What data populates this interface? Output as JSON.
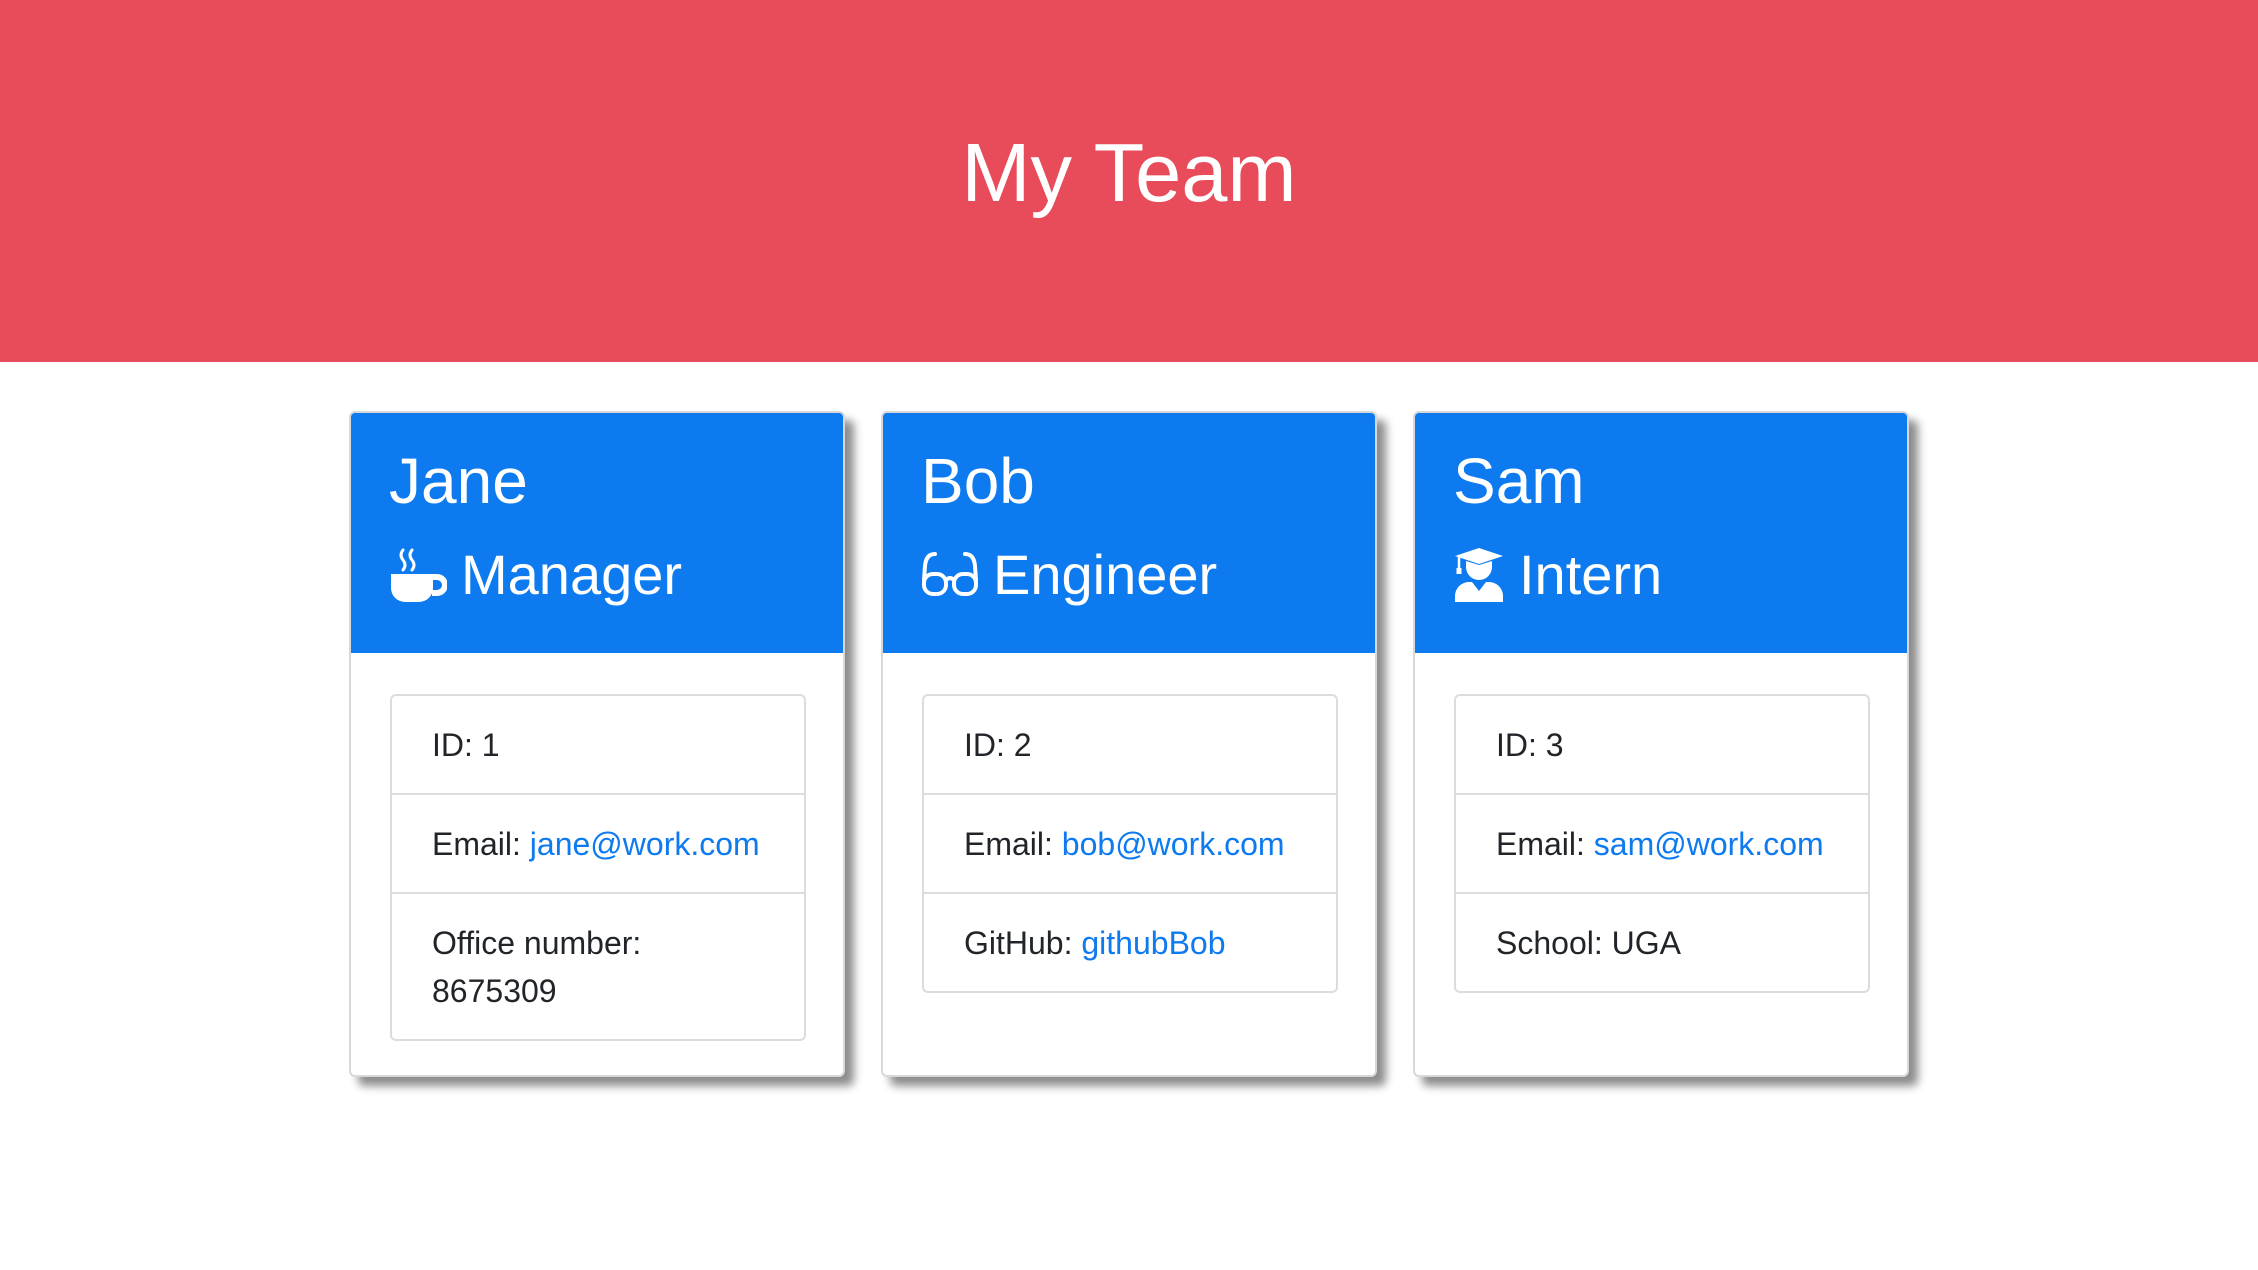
{
  "header": {
    "title": "My Team"
  },
  "colors": {
    "header_bg": "#e84c5a",
    "card_header_bg": "#0d7bef",
    "link": "#0d7bef"
  },
  "employees": [
    {
      "name": "Jane",
      "role": "Manager",
      "icon": "mug-hot-icon",
      "id_text": "ID: 1",
      "email_label": "Email: ",
      "email": "jane@work.com",
      "extra_label": "Office number: ",
      "extra_value": "8675309"
    },
    {
      "name": "Bob",
      "role": "Engineer",
      "icon": "glasses-icon",
      "id_text": "ID: 2",
      "email_label": "Email: ",
      "email": "bob@work.com",
      "extra_label": "GitHub: ",
      "extra_value": "githubBob"
    },
    {
      "name": "Sam",
      "role": "Intern",
      "icon": "user-graduate-icon",
      "id_text": "ID: 3",
      "email_label": "Email: ",
      "email": "sam@work.com",
      "extra_label": "School: ",
      "extra_value": "UGA"
    }
  ]
}
